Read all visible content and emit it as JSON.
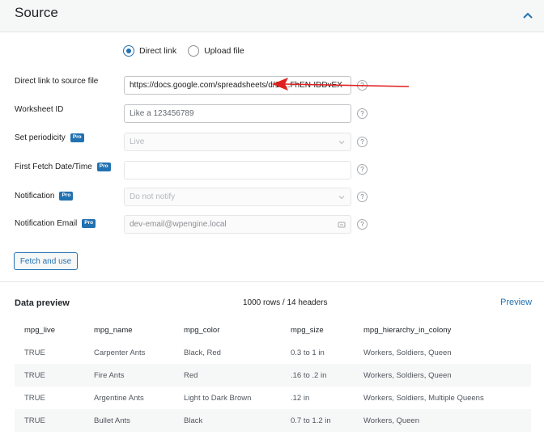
{
  "section": {
    "title": "Source"
  },
  "source_type": {
    "options": [
      {
        "label": "Direct link",
        "checked": true
      },
      {
        "label": "Upload file",
        "checked": false
      }
    ]
  },
  "form": {
    "direct_link": {
      "label": "Direct link to source file",
      "value": "https://docs.google.com/spreadsheets/d/1F...FhEN-IDDvEX"
    },
    "worksheet": {
      "label": "Worksheet ID",
      "placeholder": "Like a 123456789"
    },
    "periodicity": {
      "label": "Set periodicity",
      "badge": "Pro",
      "value": "Live"
    },
    "first_fetch": {
      "label": "First Fetch Date/Time",
      "badge": "Pro",
      "value": ""
    },
    "notification": {
      "label": "Notification",
      "badge": "Pro",
      "value": "Do not notify"
    },
    "notification_email": {
      "label": "Notification Email",
      "badge": "Pro",
      "value": "dev-email@wpengine.local"
    },
    "help_glyph": "?",
    "fetch_button": "Fetch and use"
  },
  "preview": {
    "title": "Data preview",
    "count": "1000 rows / 14 headers",
    "link": "Preview",
    "columns": [
      "mpg_live",
      "mpg_name",
      "mpg_color",
      "mpg_size",
      "mpg_hierarchy_in_colony"
    ],
    "rows": [
      [
        "TRUE",
        "Carpenter Ants",
        "Black, Red",
        "0.3 to 1 in",
        "Workers, Soldiers, Queen"
      ],
      [
        "TRUE",
        "Fire Ants",
        "Red",
        ".16 to .2 in",
        "Workers, Soldiers, Queen"
      ],
      [
        "TRUE",
        "Argentine Ants",
        "Light to Dark Brown",
        ".12 in",
        "Workers, Soldiers, Multiple Queens"
      ],
      [
        "TRUE",
        "Bullet Ants",
        "Black",
        "0.7 to 1.2 in",
        "Workers, Queen"
      ]
    ]
  },
  "colors": {
    "accent": "#2271b1",
    "arrow": "#e02020"
  }
}
